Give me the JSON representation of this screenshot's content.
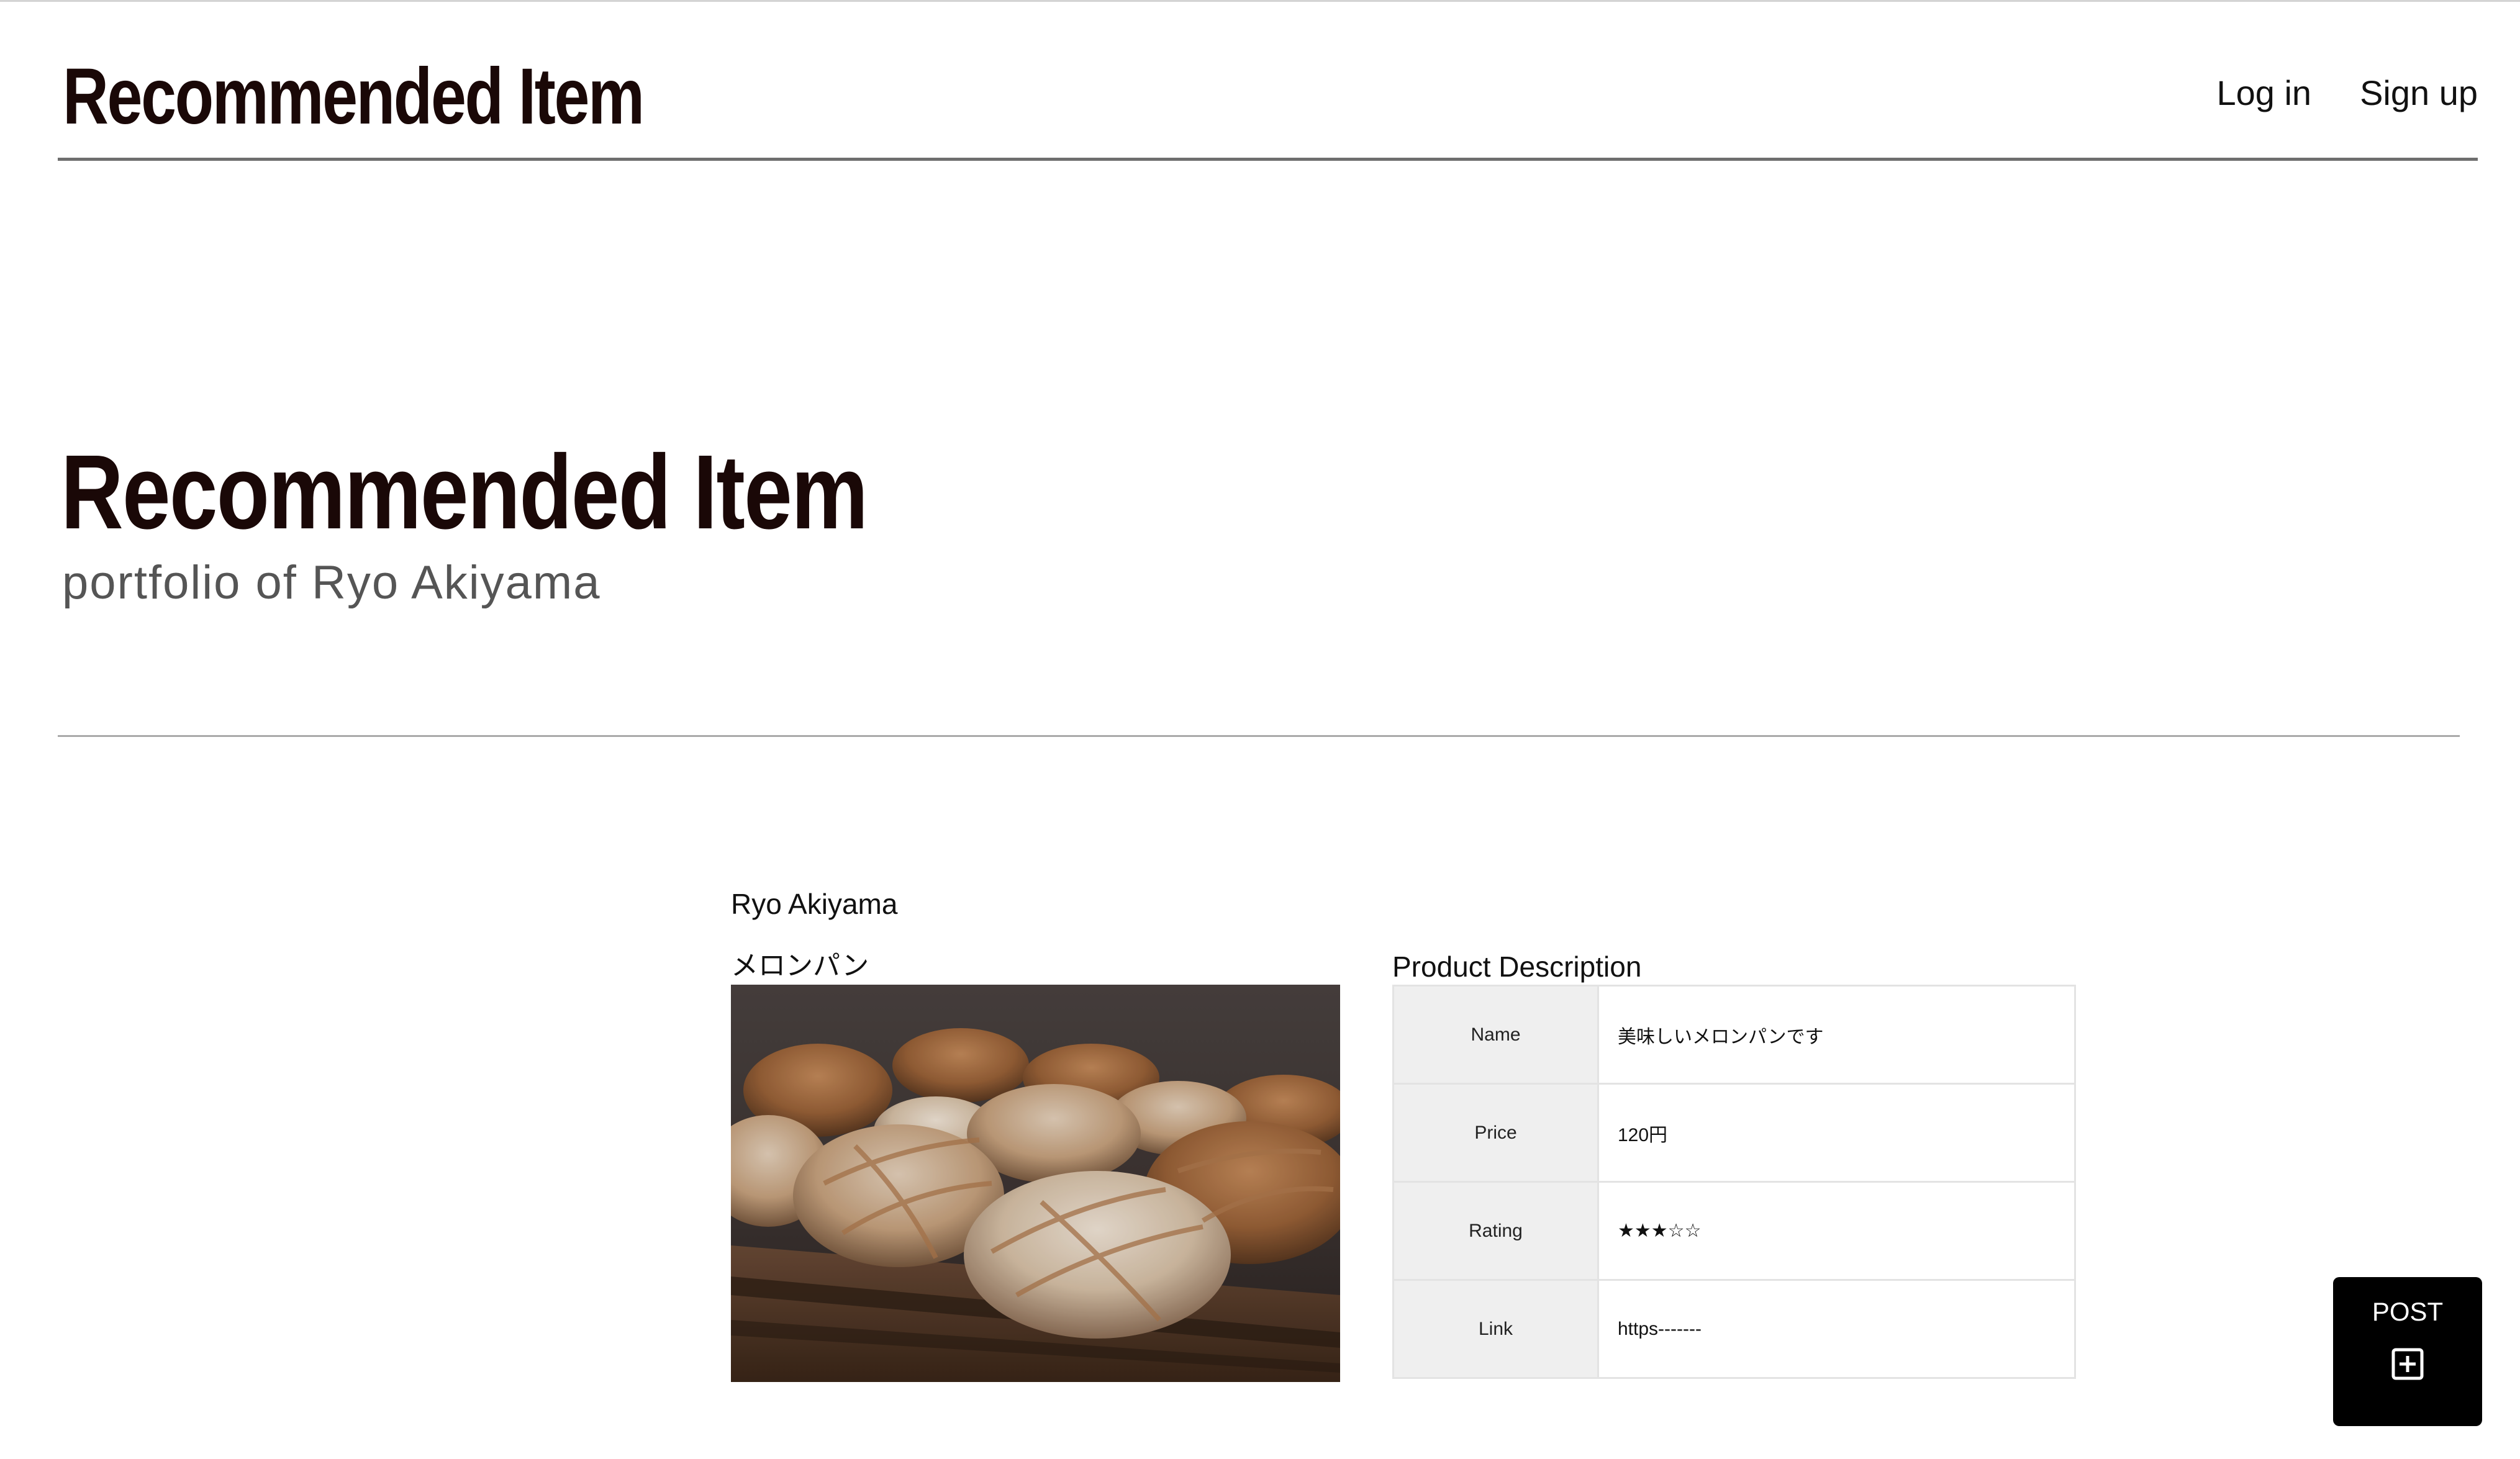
{
  "header": {
    "brand": "Recommended Item",
    "nav": {
      "login": "Log in",
      "signup": "Sign up"
    }
  },
  "hero": {
    "title": "Recommended Item",
    "subtitle": "portfolio of Ryo Akiyama"
  },
  "post": {
    "author": "Ryo Akiyama",
    "item_name": "メロンパン",
    "photo_icon": "melon-pan-photo",
    "description": {
      "title": "Product Description",
      "rows": [
        {
          "key": "Name",
          "value": "美味しいメロンパンです"
        },
        {
          "key": "Price",
          "value": "120円"
        },
        {
          "key": "Rating",
          "value": "★★★☆☆"
        },
        {
          "key": "Link",
          "value": "https-------"
        }
      ]
    }
  },
  "fab": {
    "label": "POST",
    "icon": "plus-square-icon"
  },
  "colors": {
    "brand_text": "#1a0807",
    "subtitle": "#555555",
    "fab_bg": "#000000",
    "table_key_bg": "#efefef"
  }
}
